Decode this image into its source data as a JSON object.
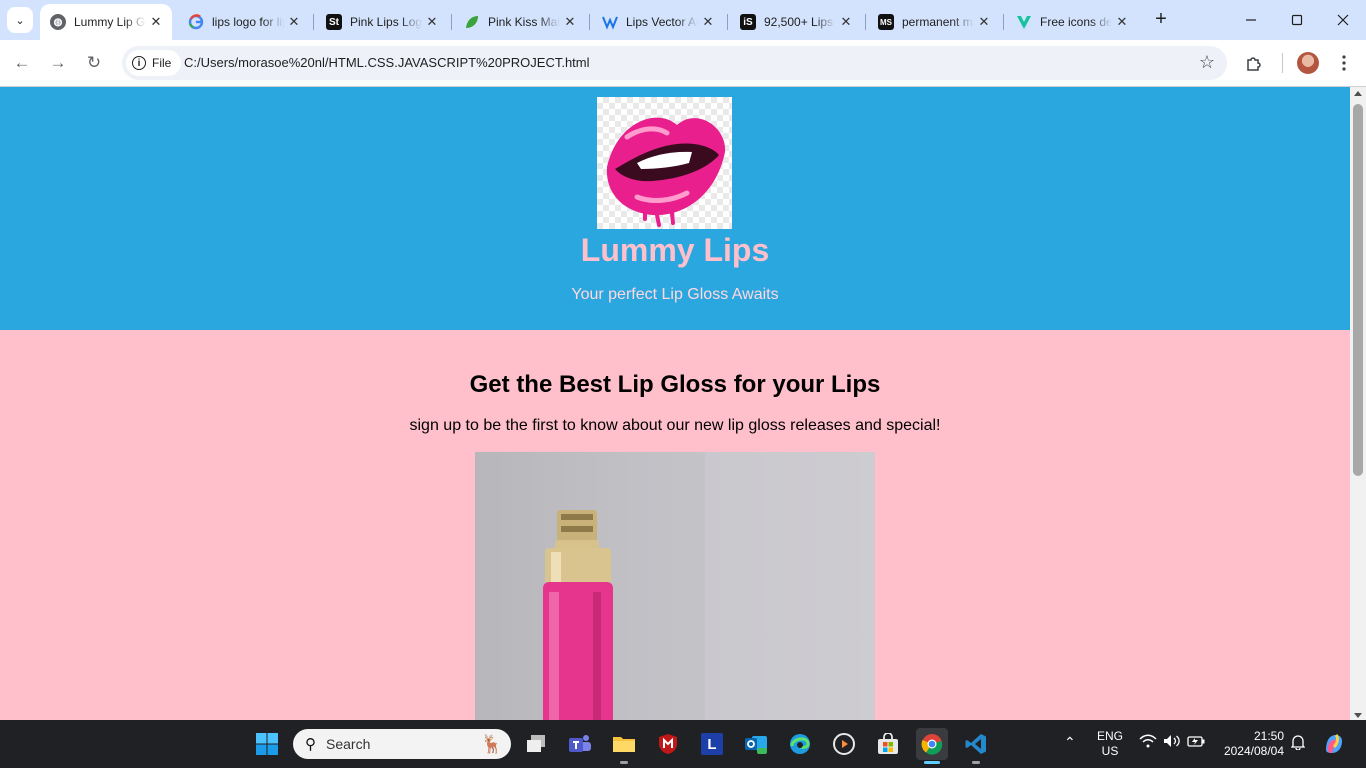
{
  "browser": {
    "tabs": [
      {
        "title": "Lummy Lip Gloss",
        "active": true,
        "favicon": "globe-icon"
      },
      {
        "title": "lips logo for lip gloss - Google Search",
        "favicon": "google-icon"
      },
      {
        "title": "Pink Lips Logo",
        "favicon": "stock-icon"
      },
      {
        "title": "Pink Kiss Makeup",
        "favicon": "leaf-icon"
      },
      {
        "title": "Lips Vector Art",
        "favicon": "vector-icon"
      },
      {
        "title": "92,500+ Lips",
        "favicon": "istock-icon"
      },
      {
        "title": "permanent makeup",
        "favicon": "ms-icon"
      },
      {
        "title": "Free icons designed",
        "favicon": "v-icon"
      }
    ],
    "close_glyph": "✕",
    "new_tab_glyph": "+",
    "address": {
      "scheme_label": "File",
      "url": "C:/Users/morasoe%20nl/HTML.CSS.JAVASCRIPT%20PROJECT.html"
    }
  },
  "page": {
    "brand": "Lummy Lips",
    "tagline": "Your perfect Lip Gloss Awaits",
    "headline": "Get the Best Lip Gloss for your Lips",
    "subline": "sign up to be the first to know about our new lip gloss releases and special!"
  },
  "taskbar": {
    "search_label": "Search",
    "language": "ENG",
    "region": "US",
    "time": "21:50",
    "date": "2024/08/04"
  },
  "colors": {
    "header_bg": "#2ba7e0",
    "page_bg": "#ffc0cb",
    "brand_text": "#ffc0cb"
  }
}
